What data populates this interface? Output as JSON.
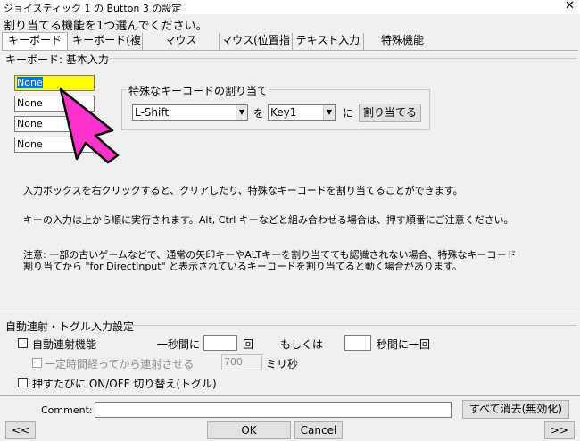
{
  "window": {
    "title": "ジョイスティック 1 の Button 3 の設定",
    "close": "✕"
  },
  "prompt": "割り当てる機能を1つ選んでください。",
  "tabs": [
    {
      "label": "キーボード"
    },
    {
      "label": "キーボード(複"
    },
    {
      "label": "マウス"
    },
    {
      "label": "マウス(位置指"
    },
    {
      "label": "テキスト入力"
    },
    {
      "label": "特殊機能"
    }
  ],
  "keyboard_group": {
    "label": "キーボード: 基本入力",
    "inputs": [
      "None",
      "None",
      "None",
      "None"
    ]
  },
  "special_key": {
    "label": "特殊なキーコードの割り当て",
    "select1": "L-Shift",
    "connector1": "を",
    "select2": "Key1",
    "connector2": "に",
    "assign_button": "割り当てる"
  },
  "help": {
    "line1": "入力ボックスを右クリックすると、クリアしたり、特殊なキーコードを割り当てることができます。",
    "line2": "キーの入力は上から順に実行されます。Alt, Ctrl キーなどと組み合わせる場合は、押す順番にご注意ください。",
    "line3a": "注意: 一部の古いゲームなどで、通常の矢印キーやALTキーを割り当てても認識されない場合、特殊なキーコード",
    "line3b": "割り当てから \"for DirectInput\" と表示されているキーコードを割り当てると動く場合があります。"
  },
  "auto": {
    "label": "自動連射・トグル入力設定",
    "rapid_fire": "自動連射機能",
    "per_second": "一秒間に",
    "times": "回",
    "or": "もしくは",
    "interval_per": "秒間に一回",
    "delay_label": "一定時間経ってから連射させる",
    "delay_value": "700",
    "ms": "ミリ秒",
    "toggle_label": "押すたびに ON/OFF 切り替え(トグル)"
  },
  "bottom": {
    "comment_label": "Comment:",
    "comment_value": "",
    "clear_all": "すべて消去(無効化)",
    "prev": "<<",
    "ok": "OK",
    "cancel": "Cancel",
    "next": ">>"
  },
  "colors": {
    "focus_input": "#ffff00",
    "selection": "#0078d7",
    "arrow_annotation": "#ff33cc"
  }
}
